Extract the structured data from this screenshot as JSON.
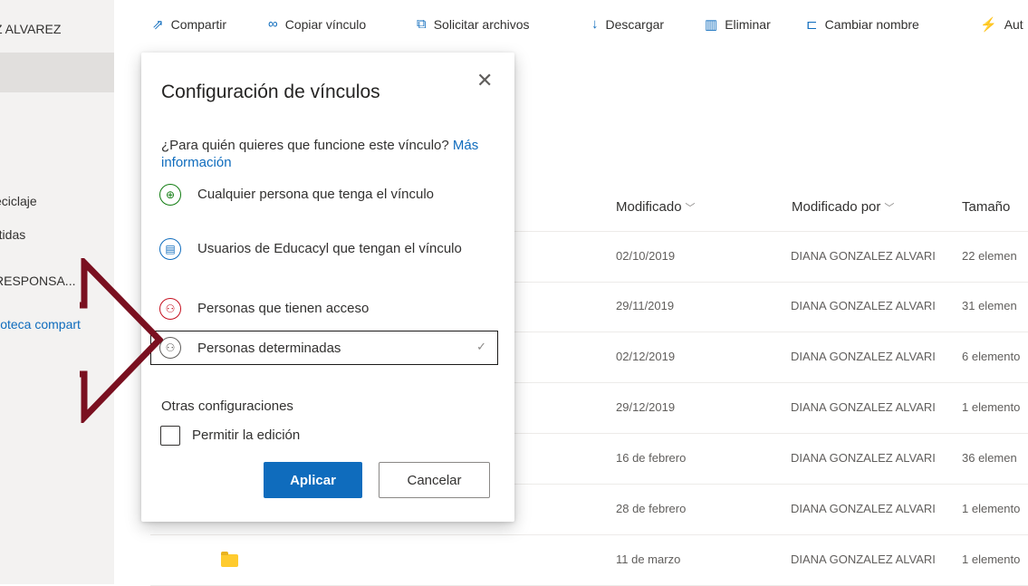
{
  "sidebar": {
    "user": "Z ALVAREZ",
    "items": [
      {
        "label": "eciclaje"
      },
      {
        "label": "rtidas"
      },
      {
        "label": "RESPONSA..."
      },
      {
        "label": "lioteca compart"
      }
    ]
  },
  "toolbar": {
    "commands": [
      {
        "label": "Compartir",
        "icon": "share-icon"
      },
      {
        "label": "Copiar vínculo",
        "icon": "link-icon"
      },
      {
        "label": "Solicitar archivos",
        "icon": "request-files-icon"
      },
      {
        "label": "Descargar",
        "icon": "download-icon"
      },
      {
        "label": "Eliminar",
        "icon": "trash-icon"
      },
      {
        "label": "Cambiar nombre",
        "icon": "rename-icon"
      },
      {
        "label": "Aut",
        "icon": "automate-icon"
      }
    ]
  },
  "table": {
    "columns": [
      "Modificado",
      "Modificado por",
      "Tamaño"
    ],
    "rows": [
      {
        "modified": "02/10/2019",
        "by": "DIANA GONZALEZ ALVARI",
        "size": "22 elemen"
      },
      {
        "modified": "29/11/2019",
        "by": "DIANA GONZALEZ ALVARI",
        "size": "31 elemen"
      },
      {
        "modified": "02/12/2019",
        "by": "DIANA GONZALEZ ALVARI",
        "size": "6 elemento"
      },
      {
        "modified": "29/12/2019",
        "by": "DIANA GONZALEZ ALVARI",
        "size": "1 elemento"
      },
      {
        "modified": "16 de febrero",
        "by": "DIANA GONZALEZ ALVARI",
        "size": "36 elemen"
      },
      {
        "modified": "28 de febrero",
        "by": "DIANA GONZALEZ ALVARI",
        "size": "1 elemento"
      },
      {
        "modified": "11 de marzo",
        "by": "DIANA GONZALEZ ALVARI",
        "size": "1 elemento"
      }
    ]
  },
  "dialog": {
    "title": "Configuración de vínculos",
    "question": "¿Para quién quieres que funcione este vínculo?",
    "more_info": "Más información",
    "options": [
      {
        "label": "Cualquier persona que tenga el vínculo",
        "icon": "globe-icon",
        "color": "#107c10"
      },
      {
        "label": "Usuarios de Educacyl que tengan el vínculo",
        "icon": "organization-icon",
        "color": "#0f6cbd"
      },
      {
        "label": "Personas que tienen acceso",
        "icon": "people-lock-icon",
        "color": "#c50f1f"
      },
      {
        "label": "Personas determinadas",
        "icon": "people-icon",
        "color": "#605e5c",
        "selected": true
      }
    ],
    "other_settings": "Otras configuraciones",
    "allow_edit": "Permitir la edición",
    "apply": "Aplicar",
    "cancel": "Cancelar"
  },
  "colors": {
    "accent": "#0f6cbd",
    "annotation_arrow": "#7a1020"
  }
}
